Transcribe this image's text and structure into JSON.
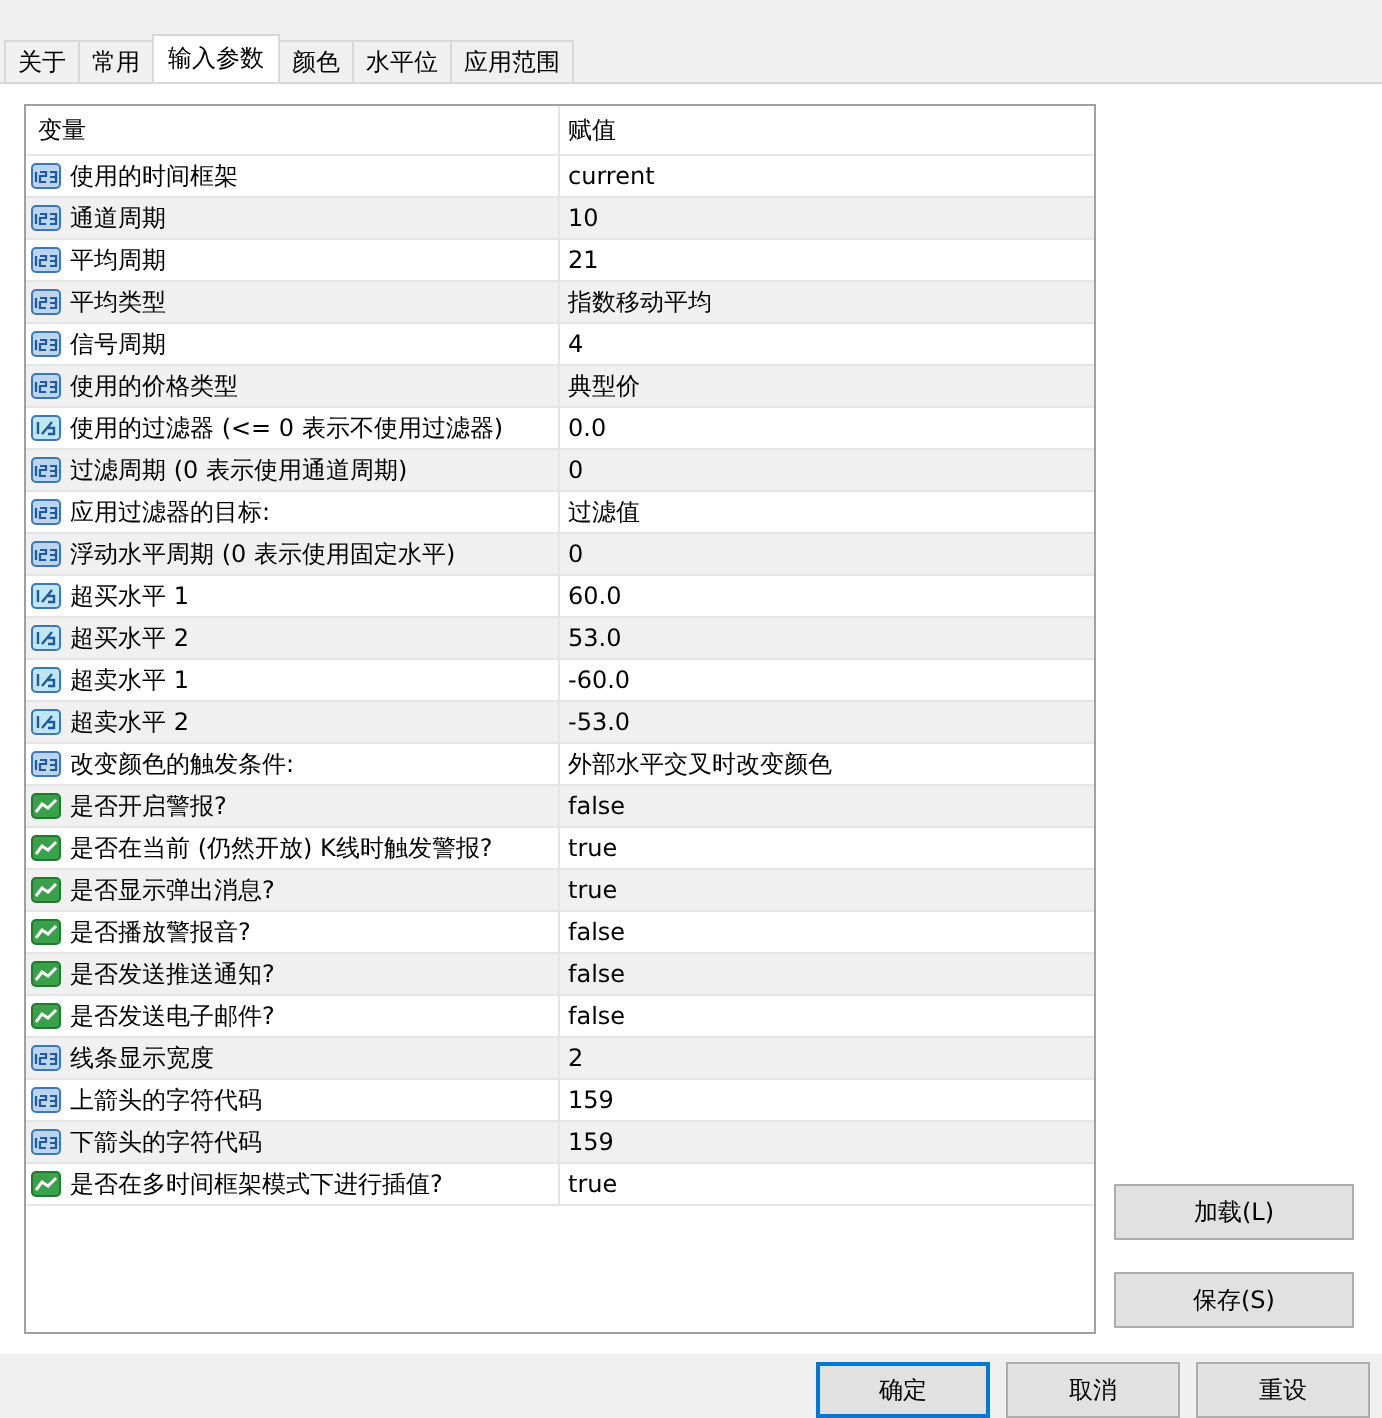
{
  "tabs": [
    {
      "label": "关于",
      "selected": false
    },
    {
      "label": "常用",
      "selected": false
    },
    {
      "label": "输入参数",
      "selected": true
    },
    {
      "label": "颜色",
      "selected": false
    },
    {
      "label": "水平位",
      "selected": false
    },
    {
      "label": "应用范围",
      "selected": false
    }
  ],
  "table": {
    "columns": [
      "变量",
      "赋值"
    ],
    "rows": [
      {
        "kind": "int",
        "name": "使用的时间框架",
        "value": "current"
      },
      {
        "kind": "int",
        "name": "通道周期",
        "value": "10"
      },
      {
        "kind": "int",
        "name": "平均周期",
        "value": "21"
      },
      {
        "kind": "int",
        "name": "平均类型",
        "value": "指数移动平均"
      },
      {
        "kind": "int",
        "name": "信号周期",
        "value": "4"
      },
      {
        "kind": "int",
        "name": "使用的价格类型",
        "value": "典型价"
      },
      {
        "kind": "double",
        "name": "使用的过滤器 (<= 0 表示不使用过滤器)",
        "value": "0.0"
      },
      {
        "kind": "int",
        "name": "过滤周期 (0 表示使用通道周期)",
        "value": "0"
      },
      {
        "kind": "int",
        "name": "应用过滤器的目标:",
        "value": "过滤值"
      },
      {
        "kind": "int",
        "name": "浮动水平周期 (0 表示使用固定水平)",
        "value": "0"
      },
      {
        "kind": "double",
        "name": "超买水平 1",
        "value": "60.0"
      },
      {
        "kind": "double",
        "name": "超买水平 2",
        "value": "53.0"
      },
      {
        "kind": "double",
        "name": "超卖水平 1",
        "value": "-60.0"
      },
      {
        "kind": "double",
        "name": "超卖水平 2",
        "value": "-53.0"
      },
      {
        "kind": "int",
        "name": "改变颜色的触发条件:",
        "value": "外部水平交叉时改变颜色"
      },
      {
        "kind": "bool",
        "name": "是否开启警报?",
        "value": "false"
      },
      {
        "kind": "bool",
        "name": "是否在当前 (仍然开放) K线时触发警报?",
        "value": "true"
      },
      {
        "kind": "bool",
        "name": "是否显示弹出消息?",
        "value": "true"
      },
      {
        "kind": "bool",
        "name": "是否播放警报音?",
        "value": "false"
      },
      {
        "kind": "bool",
        "name": "是否发送推送通知?",
        "value": "false"
      },
      {
        "kind": "bool",
        "name": "是否发送电子邮件?",
        "value": "false"
      },
      {
        "kind": "int",
        "name": "线条显示宽度",
        "value": "2"
      },
      {
        "kind": "int",
        "name": "上箭头的字符代码",
        "value": "159"
      },
      {
        "kind": "int",
        "name": "下箭头的字符代码",
        "value": "159"
      },
      {
        "kind": "bool",
        "name": "是否在多时间框架模式下进行插值?",
        "value": "true"
      }
    ]
  },
  "side_buttons": [
    "加载(L)",
    "保存(S)"
  ],
  "bottom_buttons": [
    {
      "label": "确定",
      "default": true
    },
    {
      "label": "取消",
      "default": false
    },
    {
      "label": "重设",
      "default": false
    }
  ]
}
